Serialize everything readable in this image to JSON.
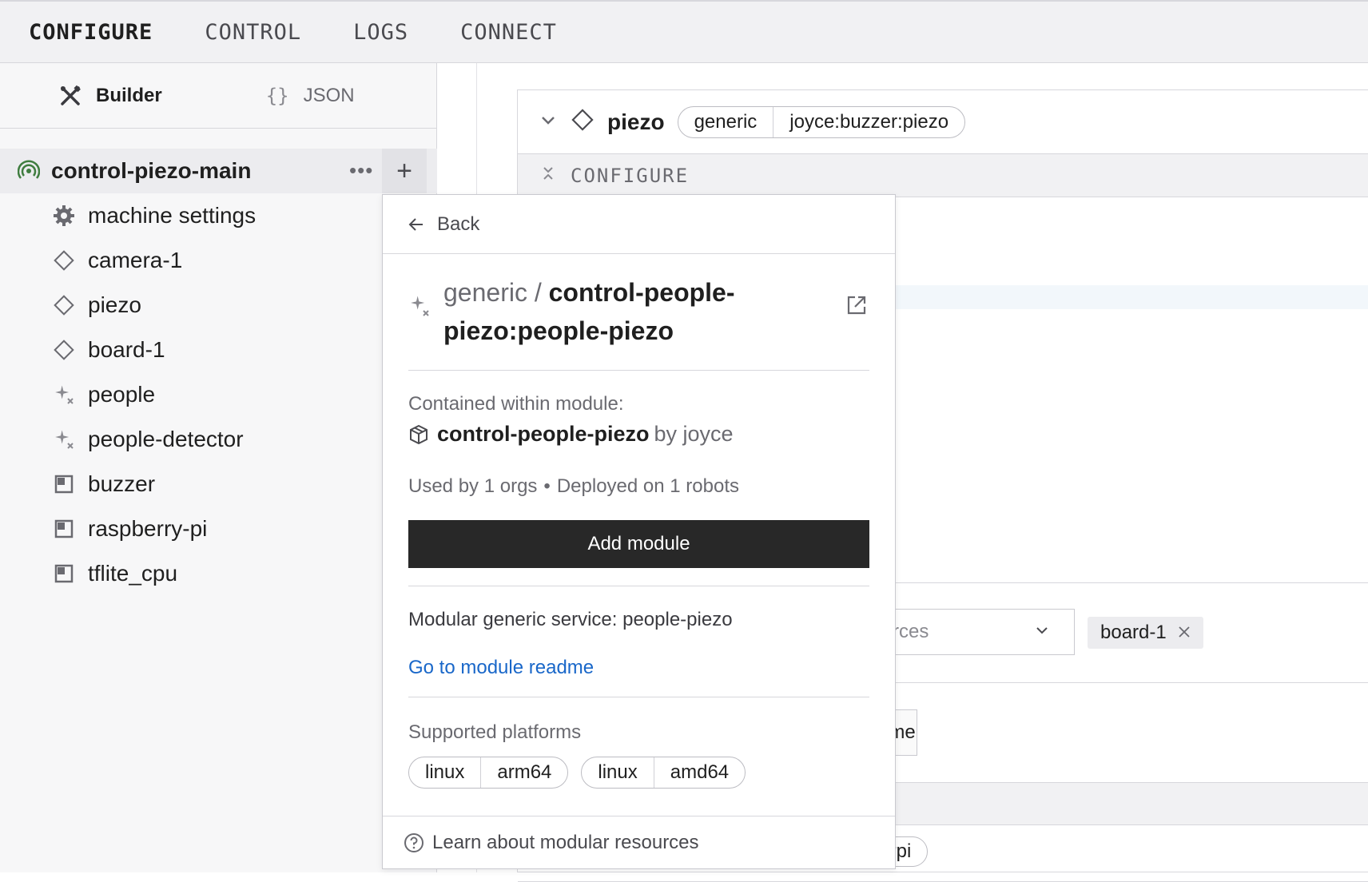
{
  "nav": {
    "tabs": [
      "CONFIGURE",
      "CONTROL",
      "LOGS",
      "CONNECT"
    ],
    "active": "CONFIGURE"
  },
  "sidebar": {
    "modes": {
      "builder": "Builder",
      "json": "JSON",
      "json_braces": "{}"
    },
    "machine": {
      "name": "control-piezo-main",
      "dots": "•••",
      "plus": "+"
    },
    "items": [
      {
        "label": "machine settings",
        "icon": "gear-icon"
      },
      {
        "label": "camera-1",
        "icon": "diamond-icon"
      },
      {
        "label": "piezo",
        "icon": "diamond-icon"
      },
      {
        "label": "board-1",
        "icon": "diamond-icon"
      },
      {
        "label": "people",
        "icon": "sparkle-icon"
      },
      {
        "label": "people-detector",
        "icon": "sparkle-icon"
      },
      {
        "label": "buzzer",
        "icon": "module-square-icon"
      },
      {
        "label": "raspberry-pi",
        "icon": "module-square-icon"
      },
      {
        "label": "tflite_cpu",
        "icon": "module-square-icon"
      }
    ]
  },
  "main": {
    "component": {
      "name": "piezo",
      "api": "generic",
      "model": "joyce:buzzer:piezo"
    },
    "configure_label": "CONFIGURE",
    "search_placeholder": "rch resources",
    "chip": "board-1",
    "add_frame": "Add frame",
    "partial_model": "erry-pi:rpi"
  },
  "popup": {
    "back": "Back",
    "namespace": "generic /",
    "name": "control-people-piezo:people-piezo",
    "contained_label": "Contained within module:",
    "module_name": "control-people-piezo",
    "module_by": "by joyce",
    "used_by": "Used by 1 orgs",
    "separator": "•",
    "deployed": "Deployed on 1 robots",
    "add_button": "Add module",
    "description": "Modular generic service: people-piezo",
    "readme_link": "Go to module readme",
    "platforms_label": "Supported platforms",
    "platforms": [
      {
        "os": "linux",
        "arch": "arm64"
      },
      {
        "os": "linux",
        "arch": "amd64"
      }
    ],
    "footer": "Learn about modular resources"
  },
  "colors": {
    "accent_link": "#1967c9",
    "button_dark": "#282828",
    "online_green": "#3f7d3f"
  }
}
